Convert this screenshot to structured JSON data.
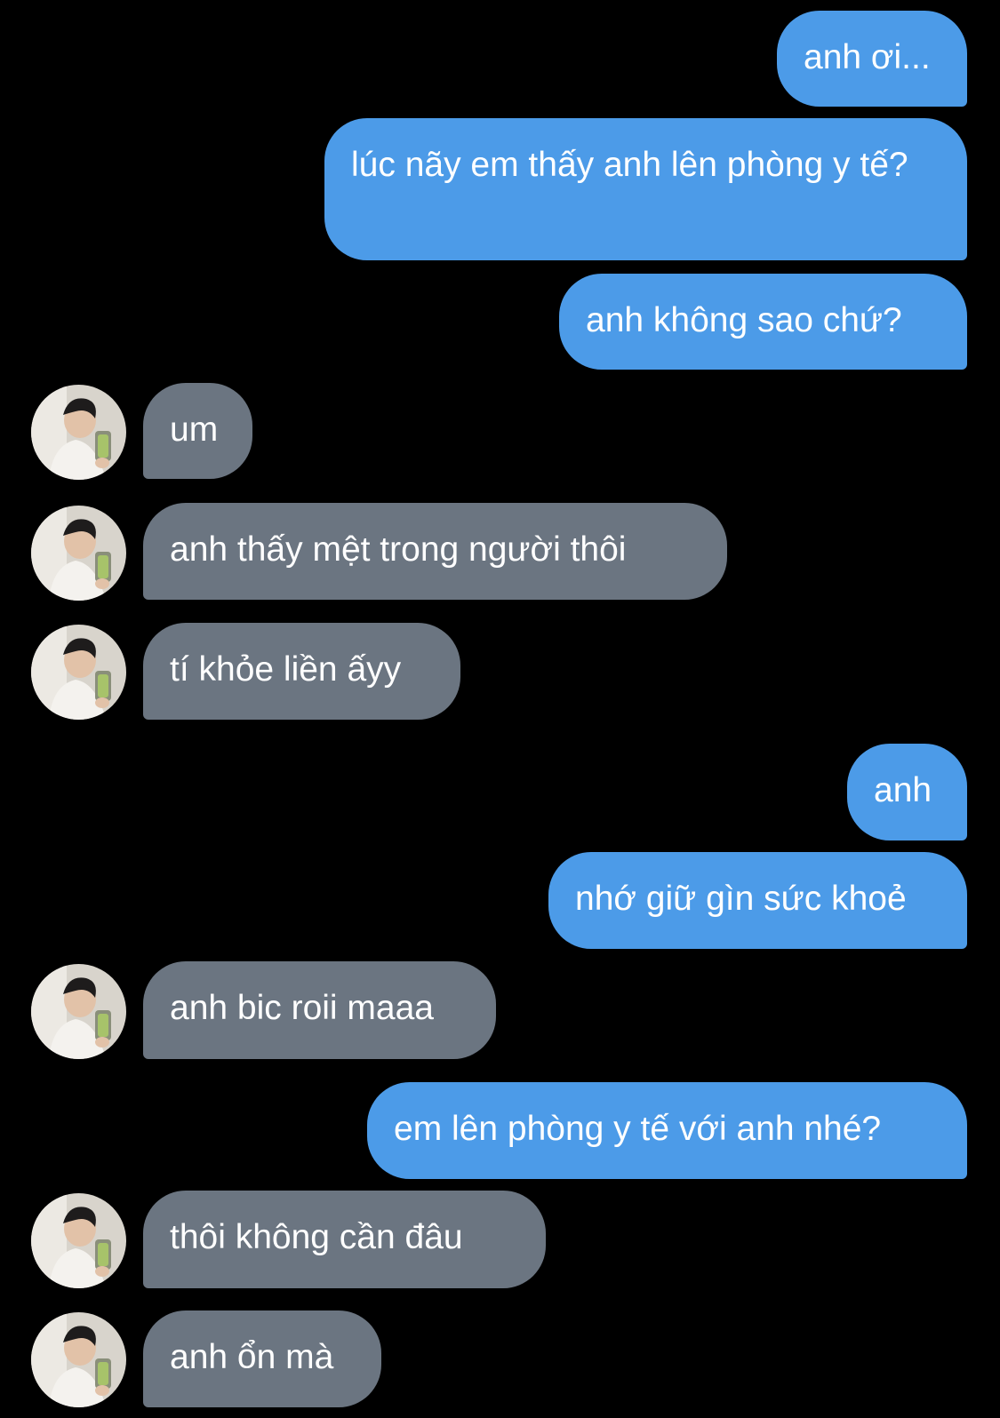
{
  "conversation": {
    "messages": [
      {
        "text": "anh ơi...",
        "sender": "me"
      },
      {
        "text": "lúc nãy em thấy anh lên phòng y tế?",
        "sender": "me"
      },
      {
        "text": "anh không sao chứ?",
        "sender": "me"
      },
      {
        "text": "um",
        "sender": "other"
      },
      {
        "text": "anh thấy mệt trong người thôi",
        "sender": "other"
      },
      {
        "text": "tí khỏe liền ấyy",
        "sender": "other"
      },
      {
        "text": "anh",
        "sender": "me"
      },
      {
        "text": "nhớ giữ gìn sức khoẻ",
        "sender": "me"
      },
      {
        "text": "anh bic roii maaa",
        "sender": "other"
      },
      {
        "text": "em lên phòng y tế với anh nhé?",
        "sender": "me"
      },
      {
        "text": "thôi không cần đâu",
        "sender": "other"
      },
      {
        "text": "anh ổn mà",
        "sender": "other"
      }
    ]
  },
  "colors": {
    "background": "#000000",
    "outgoing_bubble": "#4c9be8",
    "incoming_bubble": "#6b7581",
    "text": "#ffffff"
  },
  "icons": {
    "contact_avatar": "avatar-photo-icon"
  }
}
